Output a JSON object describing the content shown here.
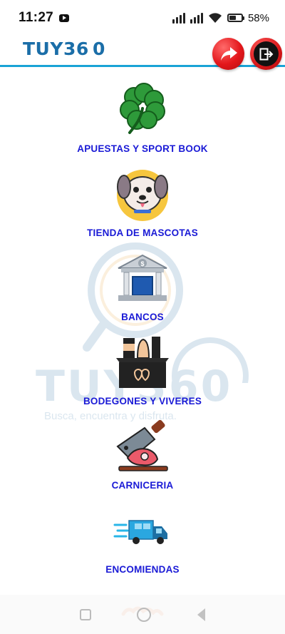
{
  "status_bar": {
    "time": "11:27",
    "battery_level": 58,
    "battery_label": "58%"
  },
  "header": {
    "logo_main": "TUY36",
    "logo_ring": "0",
    "share_icon": "share-arrow-icon",
    "exit_icon": "logout-icon",
    "accent_color": "#1aa3d6",
    "button_color": "#e3171b"
  },
  "watermark": {
    "text": "TUY360",
    "slogan": "Busca, encuentra y disfruta."
  },
  "categories": [
    {
      "label": "APUESTAS Y SPORT BOOK",
      "icon": "clover-icon"
    },
    {
      "label": "TIENDA DE MASCOTAS",
      "icon": "dog-icon"
    },
    {
      "label": "BANCOS",
      "icon": "bank-icon"
    },
    {
      "label": "BODEGONES Y VIVERES",
      "icon": "groceries-box-icon"
    },
    {
      "label": "CARNICERIA",
      "icon": "meat-cleaver-icon"
    },
    {
      "label": "ENCOMIENDAS",
      "icon": "delivery-truck-icon"
    }
  ],
  "label_color": "#1a1ad6"
}
